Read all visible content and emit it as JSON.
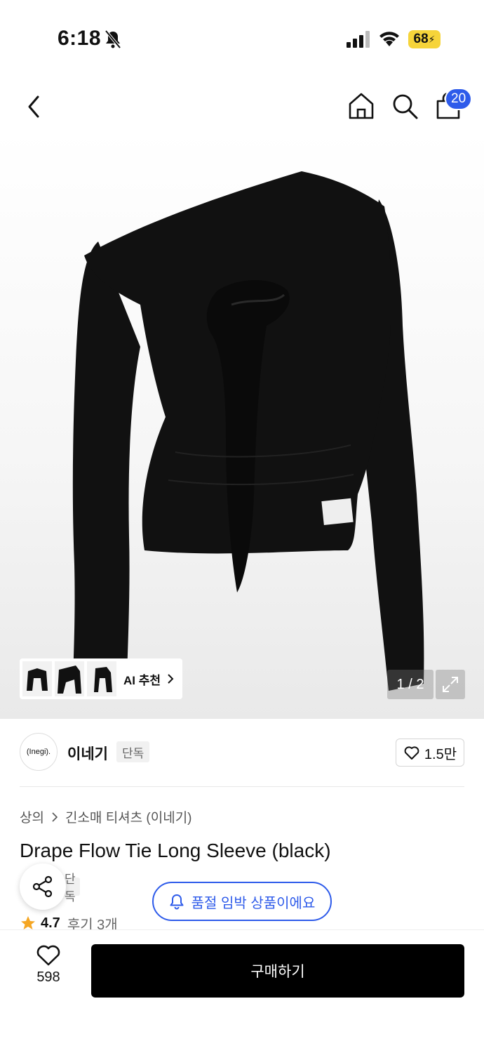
{
  "status_bar": {
    "time": "6:18",
    "battery": "68"
  },
  "nav": {
    "cart_count": "20"
  },
  "gallery": {
    "ai_recommend_label": "AI 추천",
    "page_indicator": "1 / 2"
  },
  "brand": {
    "logo_text": "(Inegi).",
    "name": "이네기",
    "tag": "단독",
    "like_count": "1.5만"
  },
  "breadcrumb": {
    "category": "상의",
    "subcategory": "긴소매 티셔츠 (이네기)"
  },
  "product": {
    "title": "Drape Flow Tie Long Sleeve (black)",
    "exclusive_tag": "단독",
    "rating": "4.7",
    "review_label": "후기 3개"
  },
  "alert": {
    "soldout_label": "품절 임박 상품이에요"
  },
  "bottom": {
    "wish_count": "598",
    "buy_label": "구매하기"
  },
  "colors": {
    "accent": "#2e5bea",
    "battery": "#f6d43a",
    "star": "#f5a623"
  }
}
